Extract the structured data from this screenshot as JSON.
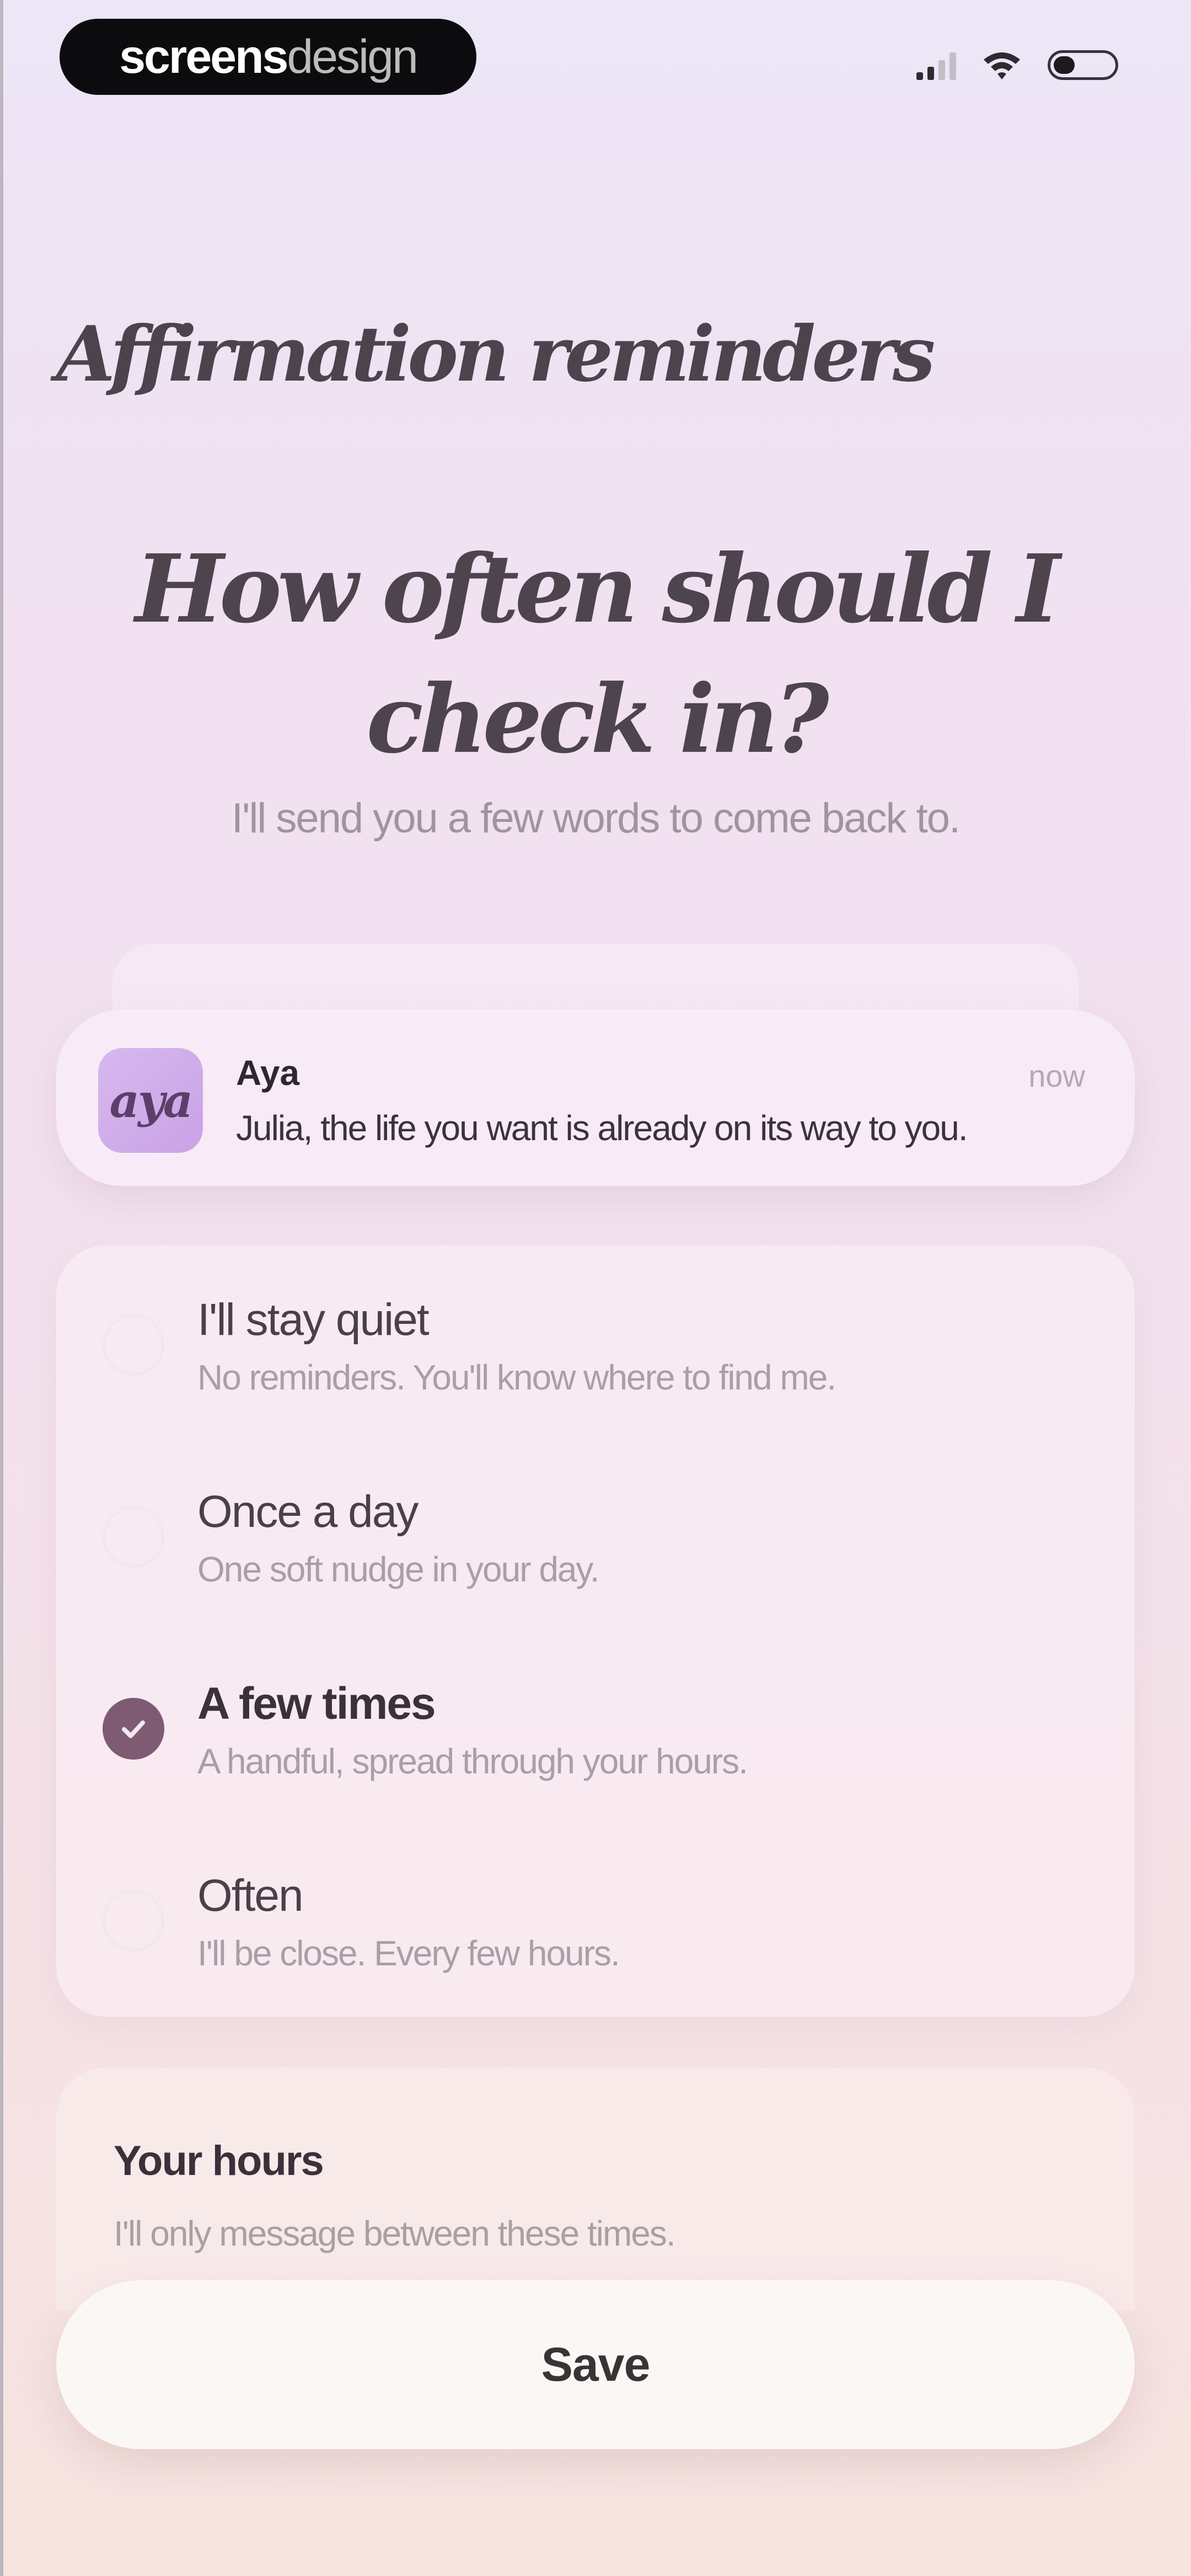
{
  "status_bar": {
    "brand_bold": "screens",
    "brand_light": "design",
    "icons": [
      "signal-icon",
      "wifi-icon",
      "battery-icon"
    ]
  },
  "header": {
    "title": "Affirmation reminders"
  },
  "main": {
    "question": "How often should I check in?",
    "subtitle": "I'll send you a few words to come back to."
  },
  "notification": {
    "app_icon_text": "aya",
    "app_name": "Aya",
    "time": "now",
    "message": "Julia, the life you want is already on its way to you."
  },
  "frequency_options": [
    {
      "title": "I'll stay quiet",
      "description": "No reminders. You'll know where to find me.",
      "selected": false
    },
    {
      "title": "Once a day",
      "description": "One soft nudge in your day.",
      "selected": false
    },
    {
      "title": "A few times",
      "description": "A handful, spread through your hours.",
      "selected": true
    },
    {
      "title": "Often",
      "description": "I'll be close. Every few hours.",
      "selected": false
    }
  ],
  "hours": {
    "title": "Your hours",
    "description": "I'll only message between these times."
  },
  "actions": {
    "save_label": "Save"
  },
  "colors": {
    "accent": "#7f5a73",
    "background_top": "#ece6f6",
    "background_bottom": "#f7e4df"
  }
}
